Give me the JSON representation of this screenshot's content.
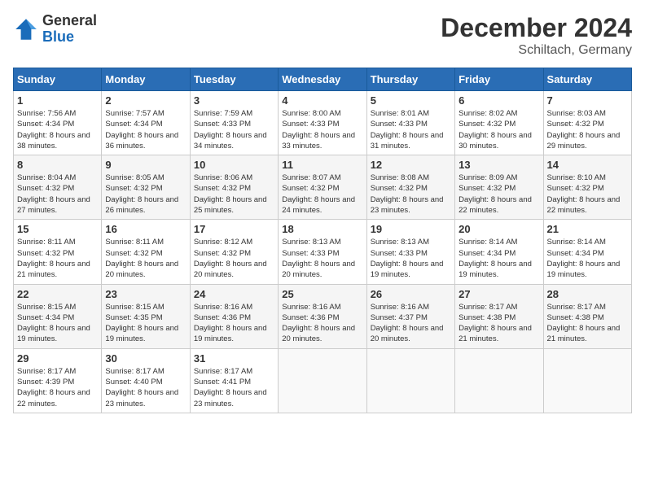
{
  "header": {
    "logo_general": "General",
    "logo_blue": "Blue",
    "title": "December 2024",
    "subtitle": "Schiltach, Germany"
  },
  "weekdays": [
    "Sunday",
    "Monday",
    "Tuesday",
    "Wednesday",
    "Thursday",
    "Friday",
    "Saturday"
  ],
  "weeks": [
    [
      {
        "day": "1",
        "sunrise": "Sunrise: 7:56 AM",
        "sunset": "Sunset: 4:34 PM",
        "daylight": "Daylight: 8 hours and 38 minutes."
      },
      {
        "day": "2",
        "sunrise": "Sunrise: 7:57 AM",
        "sunset": "Sunset: 4:34 PM",
        "daylight": "Daylight: 8 hours and 36 minutes."
      },
      {
        "day": "3",
        "sunrise": "Sunrise: 7:59 AM",
        "sunset": "Sunset: 4:33 PM",
        "daylight": "Daylight: 8 hours and 34 minutes."
      },
      {
        "day": "4",
        "sunrise": "Sunrise: 8:00 AM",
        "sunset": "Sunset: 4:33 PM",
        "daylight": "Daylight: 8 hours and 33 minutes."
      },
      {
        "day": "5",
        "sunrise": "Sunrise: 8:01 AM",
        "sunset": "Sunset: 4:33 PM",
        "daylight": "Daylight: 8 hours and 31 minutes."
      },
      {
        "day": "6",
        "sunrise": "Sunrise: 8:02 AM",
        "sunset": "Sunset: 4:32 PM",
        "daylight": "Daylight: 8 hours and 30 minutes."
      },
      {
        "day": "7",
        "sunrise": "Sunrise: 8:03 AM",
        "sunset": "Sunset: 4:32 PM",
        "daylight": "Daylight: 8 hours and 29 minutes."
      }
    ],
    [
      {
        "day": "8",
        "sunrise": "Sunrise: 8:04 AM",
        "sunset": "Sunset: 4:32 PM",
        "daylight": "Daylight: 8 hours and 27 minutes."
      },
      {
        "day": "9",
        "sunrise": "Sunrise: 8:05 AM",
        "sunset": "Sunset: 4:32 PM",
        "daylight": "Daylight: 8 hours and 26 minutes."
      },
      {
        "day": "10",
        "sunrise": "Sunrise: 8:06 AM",
        "sunset": "Sunset: 4:32 PM",
        "daylight": "Daylight: 8 hours and 25 minutes."
      },
      {
        "day": "11",
        "sunrise": "Sunrise: 8:07 AM",
        "sunset": "Sunset: 4:32 PM",
        "daylight": "Daylight: 8 hours and 24 minutes."
      },
      {
        "day": "12",
        "sunrise": "Sunrise: 8:08 AM",
        "sunset": "Sunset: 4:32 PM",
        "daylight": "Daylight: 8 hours and 23 minutes."
      },
      {
        "day": "13",
        "sunrise": "Sunrise: 8:09 AM",
        "sunset": "Sunset: 4:32 PM",
        "daylight": "Daylight: 8 hours and 22 minutes."
      },
      {
        "day": "14",
        "sunrise": "Sunrise: 8:10 AM",
        "sunset": "Sunset: 4:32 PM",
        "daylight": "Daylight: 8 hours and 22 minutes."
      }
    ],
    [
      {
        "day": "15",
        "sunrise": "Sunrise: 8:11 AM",
        "sunset": "Sunset: 4:32 PM",
        "daylight": "Daylight: 8 hours and 21 minutes."
      },
      {
        "day": "16",
        "sunrise": "Sunrise: 8:11 AM",
        "sunset": "Sunset: 4:32 PM",
        "daylight": "Daylight: 8 hours and 20 minutes."
      },
      {
        "day": "17",
        "sunrise": "Sunrise: 8:12 AM",
        "sunset": "Sunset: 4:32 PM",
        "daylight": "Daylight: 8 hours and 20 minutes."
      },
      {
        "day": "18",
        "sunrise": "Sunrise: 8:13 AM",
        "sunset": "Sunset: 4:33 PM",
        "daylight": "Daylight: 8 hours and 20 minutes."
      },
      {
        "day": "19",
        "sunrise": "Sunrise: 8:13 AM",
        "sunset": "Sunset: 4:33 PM",
        "daylight": "Daylight: 8 hours and 19 minutes."
      },
      {
        "day": "20",
        "sunrise": "Sunrise: 8:14 AM",
        "sunset": "Sunset: 4:34 PM",
        "daylight": "Daylight: 8 hours and 19 minutes."
      },
      {
        "day": "21",
        "sunrise": "Sunrise: 8:14 AM",
        "sunset": "Sunset: 4:34 PM",
        "daylight": "Daylight: 8 hours and 19 minutes."
      }
    ],
    [
      {
        "day": "22",
        "sunrise": "Sunrise: 8:15 AM",
        "sunset": "Sunset: 4:34 PM",
        "daylight": "Daylight: 8 hours and 19 minutes."
      },
      {
        "day": "23",
        "sunrise": "Sunrise: 8:15 AM",
        "sunset": "Sunset: 4:35 PM",
        "daylight": "Daylight: 8 hours and 19 minutes."
      },
      {
        "day": "24",
        "sunrise": "Sunrise: 8:16 AM",
        "sunset": "Sunset: 4:36 PM",
        "daylight": "Daylight: 8 hours and 19 minutes."
      },
      {
        "day": "25",
        "sunrise": "Sunrise: 8:16 AM",
        "sunset": "Sunset: 4:36 PM",
        "daylight": "Daylight: 8 hours and 20 minutes."
      },
      {
        "day": "26",
        "sunrise": "Sunrise: 8:16 AM",
        "sunset": "Sunset: 4:37 PM",
        "daylight": "Daylight: 8 hours and 20 minutes."
      },
      {
        "day": "27",
        "sunrise": "Sunrise: 8:17 AM",
        "sunset": "Sunset: 4:38 PM",
        "daylight": "Daylight: 8 hours and 21 minutes."
      },
      {
        "day": "28",
        "sunrise": "Sunrise: 8:17 AM",
        "sunset": "Sunset: 4:38 PM",
        "daylight": "Daylight: 8 hours and 21 minutes."
      }
    ],
    [
      {
        "day": "29",
        "sunrise": "Sunrise: 8:17 AM",
        "sunset": "Sunset: 4:39 PM",
        "daylight": "Daylight: 8 hours and 22 minutes."
      },
      {
        "day": "30",
        "sunrise": "Sunrise: 8:17 AM",
        "sunset": "Sunset: 4:40 PM",
        "daylight": "Daylight: 8 hours and 23 minutes."
      },
      {
        "day": "31",
        "sunrise": "Sunrise: 8:17 AM",
        "sunset": "Sunset: 4:41 PM",
        "daylight": "Daylight: 8 hours and 23 minutes."
      },
      null,
      null,
      null,
      null
    ]
  ]
}
